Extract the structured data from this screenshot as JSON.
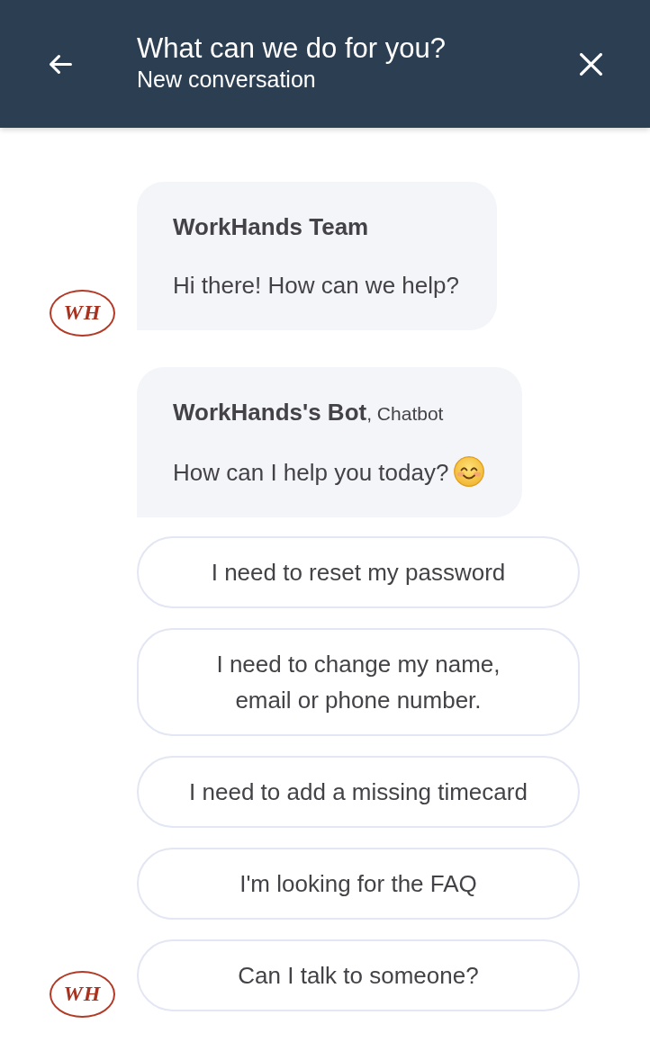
{
  "header": {
    "title": "What can we do for you?",
    "subtitle": "New conversation"
  },
  "groups": [
    {
      "avatar": {
        "monogram": "WH"
      },
      "messages": [
        {
          "sender": "WorkHands Team",
          "text": "Hi there! How can we help?"
        }
      ]
    },
    {
      "avatar": {
        "monogram": "WH"
      },
      "messages": [
        {
          "sender": "WorkHands's Bot",
          "sender_role": ", Chatbot",
          "text": "How can I help you today?",
          "smiley": true
        }
      ],
      "quick_replies": [
        "I need to reset my password",
        "I need to change my name,\nemail or phone number.",
        "I need to add a missing timecard",
        "I'm looking for the FAQ",
        "Can I talk to someone?"
      ]
    }
  ]
}
